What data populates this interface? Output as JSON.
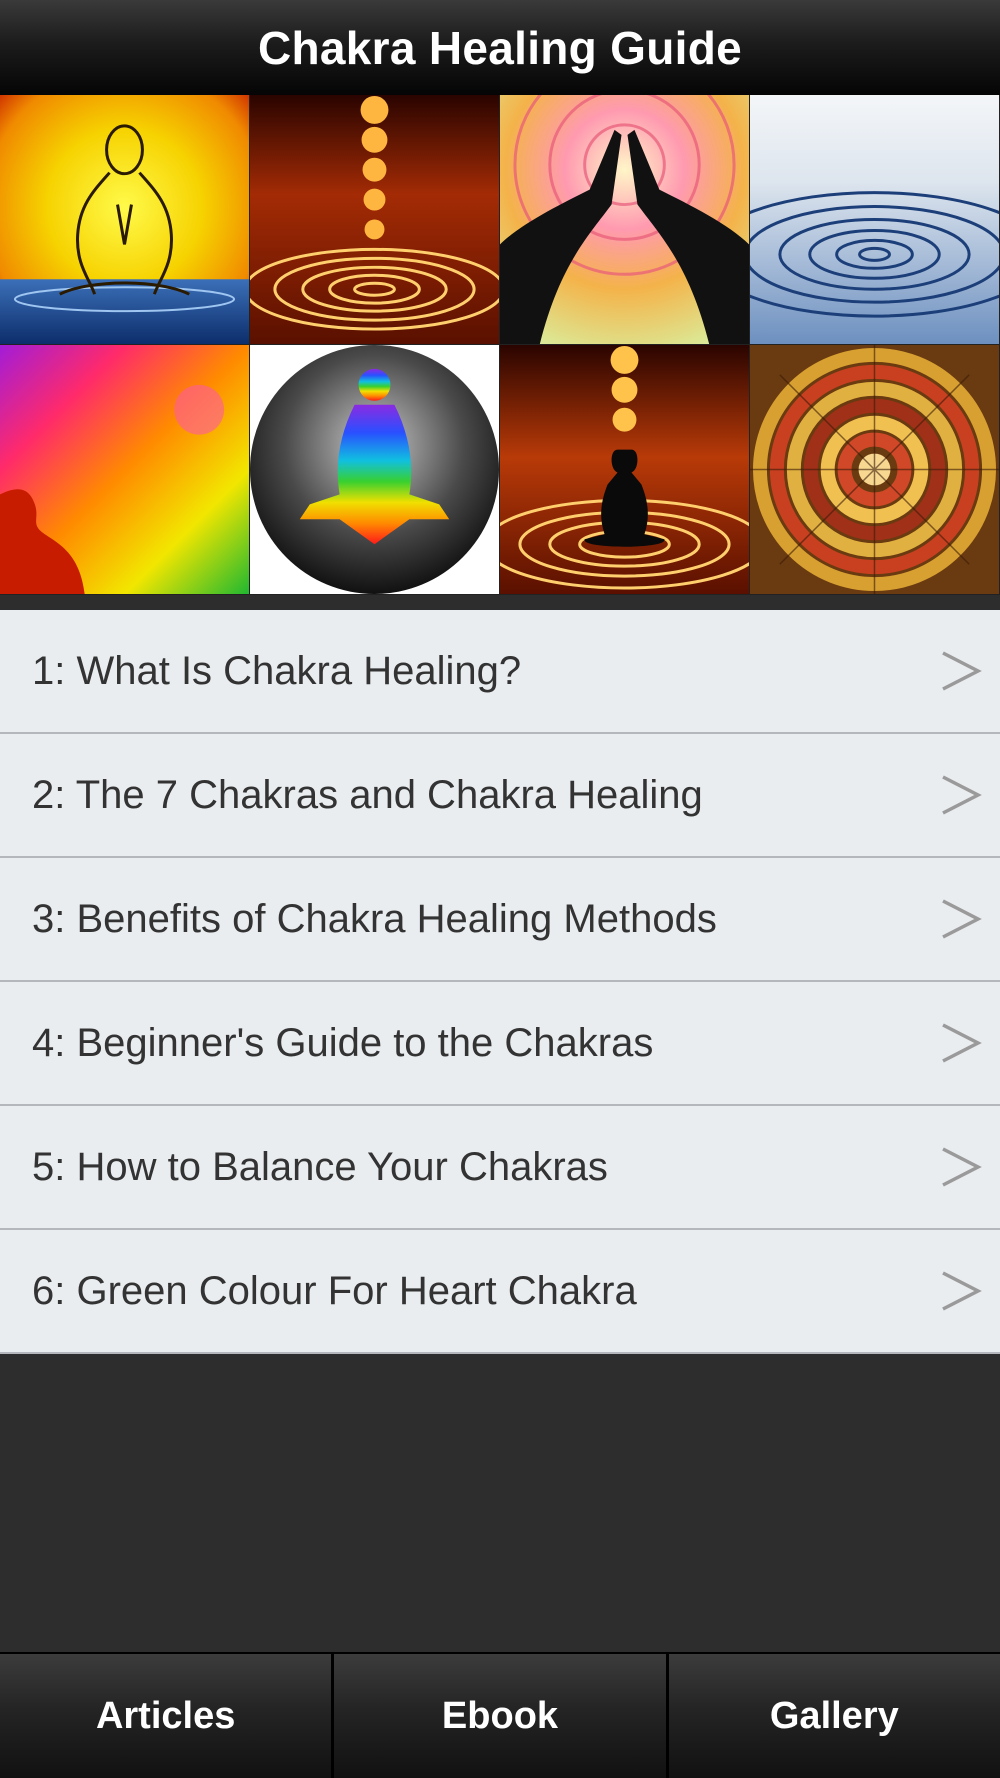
{
  "app": {
    "title": "Chakra Healing Guide"
  },
  "articles": [
    {
      "label": "1: What Is Chakra Healing?"
    },
    {
      "label": "2: The 7 Chakras and Chakra Healing"
    },
    {
      "label": "3: Benefits of Chakra Healing Methods"
    },
    {
      "label": "4: Beginner's Guide to the Chakras"
    },
    {
      "label": "5: How to Balance Your Chakras"
    },
    {
      "label": "6: Green Colour For Heart Chakra"
    }
  ],
  "row_icon": "chevron-right-icon",
  "tabs": [
    {
      "label": "Articles"
    },
    {
      "label": "Ebook"
    },
    {
      "label": "Gallery"
    }
  ],
  "colors": {
    "header_bg": "#1c1c1c",
    "list_row_bg": "#e9edf0",
    "body_bg": "#2d2d2d",
    "text_dark": "#333333"
  }
}
